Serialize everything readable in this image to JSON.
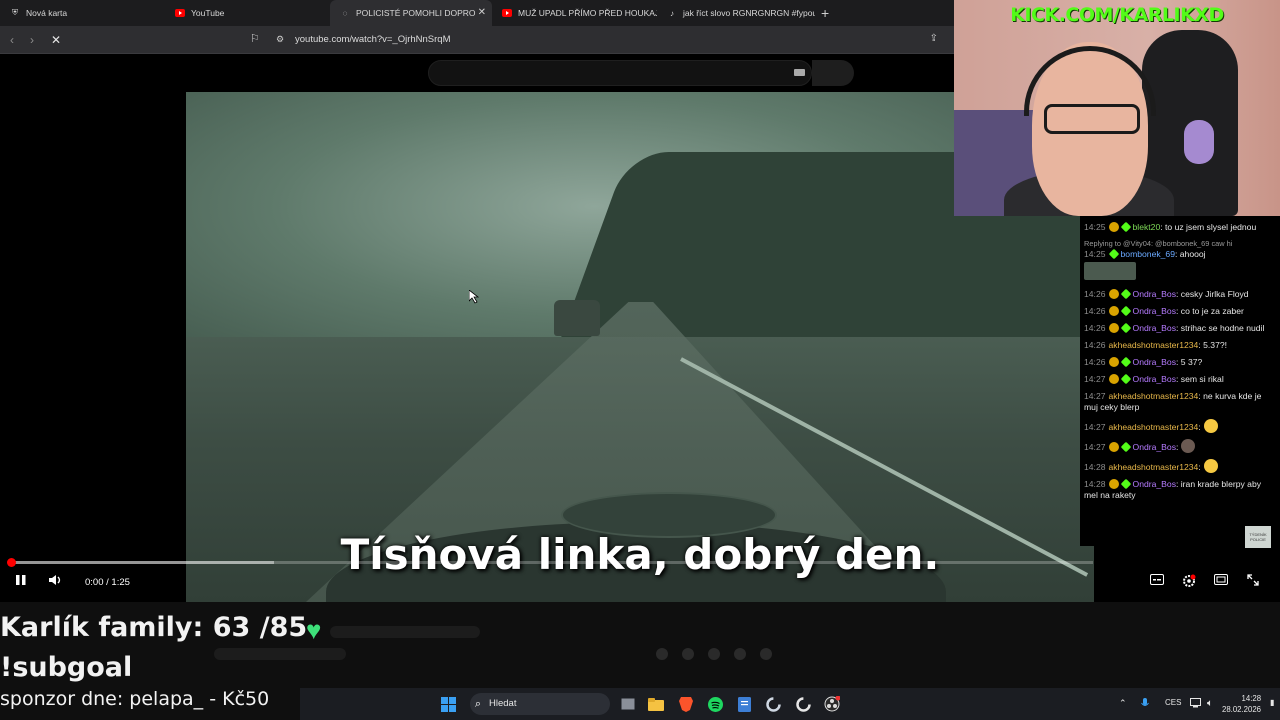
{
  "browser": {
    "tabs": [
      {
        "label": "Nová karta",
        "icon": "shield-icon",
        "active": false
      },
      {
        "label": "YouTube",
        "icon": "youtube-icon",
        "active": false
      },
      {
        "label": "POLICISTÉ POMOHLI DOPRO",
        "icon": "loading-icon",
        "active": true
      },
      {
        "label": "MUŽ UPADL PŘÍMO PŘED HOUKAJÍC",
        "icon": "youtube-icon",
        "active": false
      },
      {
        "label": "jak říct slovo RGNRGNRGN #fypou",
        "icon": "tiktok-icon",
        "active": false
      }
    ],
    "new_tab": "+",
    "close_glyph": "✕",
    "url": "youtube.com/watch?v=_OjrhNnSrqM"
  },
  "video": {
    "subtitle": "Tísňová linka, dobrý den.",
    "time": "0:00 / 1:25",
    "progress": 0.0,
    "buffered": 0.243
  },
  "chat": {
    "messages": [
      {
        "time": "14:25",
        "user": "blekt20",
        "text": ": to uz jsem slysel jednou",
        "color": "g"
      },
      {
        "reply": "Replying to @Vity04: @bombonek_69 caw hi",
        "time": "14:25",
        "user": "bombonek_69",
        "text": ": ahoooj",
        "color": "b"
      },
      {
        "time": "14:26",
        "user": "Ondra_Bos",
        "text": ": cesky Jirlka Floyd",
        "color": "p"
      },
      {
        "time": "14:26",
        "user": "Ondra_Bos",
        "text": ": co to je za zaber",
        "color": "p"
      },
      {
        "time": "14:26",
        "user": "Ondra_Bos",
        "text": ": strihac se hodne nudil",
        "color": "p"
      },
      {
        "time": "14:26",
        "user": "akheadshotmaster1234",
        "text": ": 5.37?!",
        "color": "o"
      },
      {
        "time": "14:26",
        "user": "Ondra_Bos",
        "text": ": 5 37?",
        "color": "p"
      },
      {
        "time": "14:27",
        "user": "Ondra_Bos",
        "text": ": sem si rikal",
        "color": "p"
      },
      {
        "time": "14:27",
        "user": "akheadshotmaster1234",
        "text": ": ne kurva kde je muj ceky blerp",
        "color": "o"
      },
      {
        "time": "14:27",
        "user": "akheadshotmaster1234",
        "text": ":",
        "color": "o"
      },
      {
        "time": "14:27",
        "user": "Ondra_Bos",
        "text": ":",
        "color": "p"
      },
      {
        "time": "14:28",
        "user": "akheadshotmaster1234",
        "text": ":",
        "color": "o"
      },
      {
        "time": "14:28",
        "user": "Ondra_Bos",
        "text": ": iran krade blerpy aby mel na rakety",
        "color": "p"
      }
    ],
    "police_badge": "TÝDENÍK POLICIE"
  },
  "webcam": {
    "overlay_url": "KICK.COM/KARLIKXD"
  },
  "overlay": {
    "family_goal": "Karlík family: 63 /85",
    "subgoal": "!subgoal",
    "sponsor": "sponzor dne: pelapa_ - Kč50"
  },
  "taskbar": {
    "search_label": "Hledat",
    "lang": "CES",
    "time": "14:28",
    "date": "28.02.2026"
  },
  "colors": {
    "kick_green": "#53fc18",
    "heart": "#3ee07a",
    "progress_red": "#ff0000"
  }
}
